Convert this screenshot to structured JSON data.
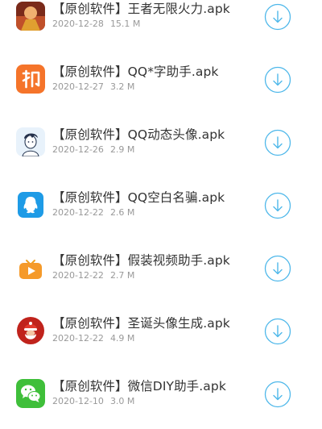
{
  "accent_color": "#4fb8ea",
  "items": [
    {
      "title": "【原创软件】王者无限火力.apk",
      "date": "2020-12-28",
      "size": "15.1 M",
      "icon": "game-hero-icon"
    },
    {
      "title": "【原创软件】QQ*字助手.apk",
      "date": "2020-12-27",
      "size": "3.2 M",
      "icon": "orange-chinese-char-icon"
    },
    {
      "title": "【原创软件】QQ动态头像.apk",
      "date": "2020-12-26",
      "size": "2.9 M",
      "icon": "avatar-boy-icon"
    },
    {
      "title": "【原创软件】QQ空白名骗.apk",
      "date": "2020-12-22",
      "size": "2.6 M",
      "icon": "qq-penguin-icon"
    },
    {
      "title": "【原创软件】假装视频助手.apk",
      "date": "2020-12-22",
      "size": "2.7 M",
      "icon": "video-tv-icon"
    },
    {
      "title": "【原创软件】圣诞头像生成.apk",
      "date": "2020-12-22",
      "size": "4.9 M",
      "icon": "santa-icon"
    },
    {
      "title": "【原创软件】微信DIY助手.apk",
      "date": "2020-12-10",
      "size": "3.0 M",
      "icon": "wechat-icon"
    }
  ]
}
